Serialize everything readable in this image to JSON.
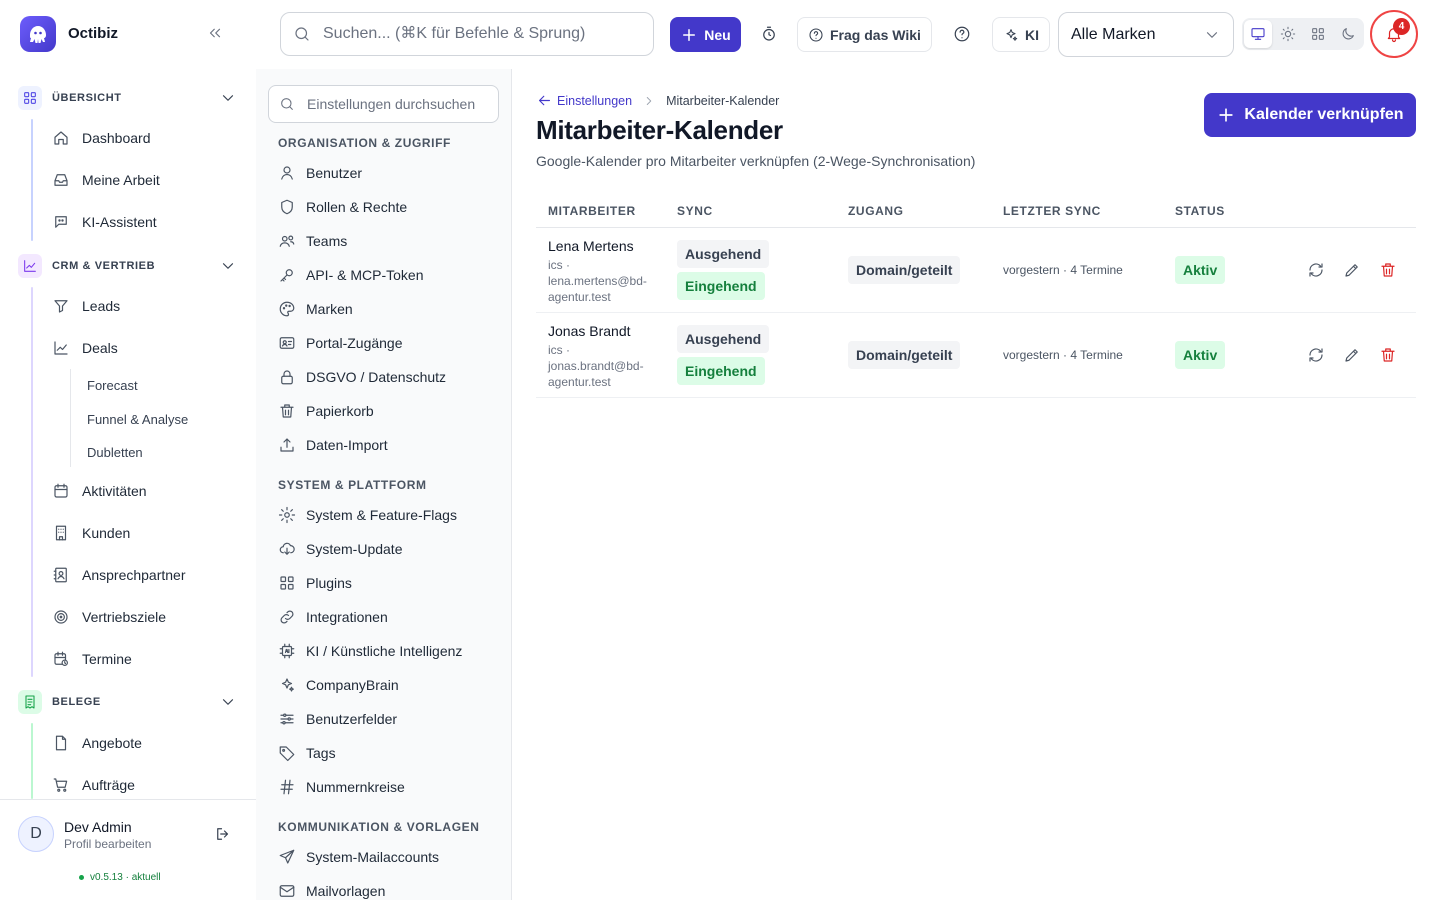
{
  "app": {
    "name": "Octibiz"
  },
  "topbar": {
    "search_placeholder": "Suchen... (⌘K für Befehle & Sprung)",
    "new_label": "Neu",
    "wiki_label": "Frag das Wiki",
    "ai_label": "KI",
    "brand_select": "Alle Marken",
    "notification_count": "4"
  },
  "sidebar": {
    "sections": [
      {
        "label": "ÜBERSICHT",
        "items": [
          "Dashboard",
          "Meine Arbeit",
          "KI-Assistent"
        ]
      },
      {
        "label": "CRM & VERTRIEB",
        "items": [
          "Leads",
          "Deals",
          "Aktivitäten",
          "Kunden",
          "Ansprechpartner",
          "Vertriebsziele",
          "Termine"
        ],
        "deals_sub": [
          "Forecast",
          "Funnel & Analyse",
          "Dubletten"
        ]
      },
      {
        "label": "BELEGE",
        "items": [
          "Angebote",
          "Aufträge"
        ]
      }
    ],
    "user": {
      "avatar": "D",
      "name": "Dev Admin",
      "profile": "Profil bearbeiten",
      "version": "v0.5.13 · aktuell"
    }
  },
  "settings": {
    "search_placeholder": "Einstellungen durchsuchen",
    "groups": [
      {
        "label": "ORGANISATION & ZUGRIFF",
        "items": [
          "Benutzer",
          "Rollen & Rechte",
          "Teams",
          "API- & MCP-Token",
          "Marken",
          "Portal-Zugänge",
          "DSGVO / Datenschutz",
          "Papierkorb",
          "Daten-Import"
        ]
      },
      {
        "label": "SYSTEM & PLATTFORM",
        "items": [
          "System & Feature-Flags",
          "System-Update",
          "Plugins",
          "Integrationen",
          "KI / Künstliche Intelligenz",
          "CompanyBrain",
          "Benutzerfelder",
          "Tags",
          "Nummernkreise"
        ]
      },
      {
        "label": "KOMMUNIKATION & VORLAGEN",
        "items": [
          "System-Mailaccounts",
          "Mailvorlagen"
        ]
      }
    ]
  },
  "main": {
    "breadcrumb": {
      "parent": "Einstellungen",
      "current": "Mitarbeiter-Kalender"
    },
    "title": "Mitarbeiter-Kalender",
    "subtitle": "Google-Kalender pro Mitarbeiter verknüpfen (2-Wege-Synchronisation)",
    "link_button": "Kalender verknüpfen",
    "columns": [
      "MITARBEITER",
      "SYNC",
      "ZUGANG",
      "LETZTER SYNC",
      "STATUS"
    ],
    "rows": [
      {
        "name": "Lena Mertens",
        "mail": "ics · lena.mertens@bd-agentur.test",
        "sync_out": "Ausgehend",
        "sync_in": "Eingehend",
        "access": "Domain/geteilt",
        "last_sync": "vorgestern · 4 Termine",
        "status": "Aktiv"
      },
      {
        "name": "Jonas Brandt",
        "mail": "ics · jonas.brandt@bd-agentur.test",
        "sync_out": "Ausgehend",
        "sync_in": "Eingehend",
        "access": "Domain/geteilt",
        "last_sync": "vorgestern · 4 Termine",
        "status": "Aktiv"
      }
    ]
  },
  "colors": {
    "accent": "#4338ca",
    "success_bg": "#dcfce7",
    "success_text": "#15803d",
    "danger": "#dc2626"
  },
  "icons": [
    "octopus-logo-icon",
    "chevrons-left-icon",
    "search-icon",
    "plus-icon",
    "timer-icon",
    "help-circle-icon",
    "sparkles-icon",
    "chevron-down-icon",
    "monitor-icon",
    "sun-icon",
    "grid-icon",
    "moon-icon",
    "bell-icon",
    "refresh-icon",
    "pencil-icon",
    "trash-icon"
  ]
}
